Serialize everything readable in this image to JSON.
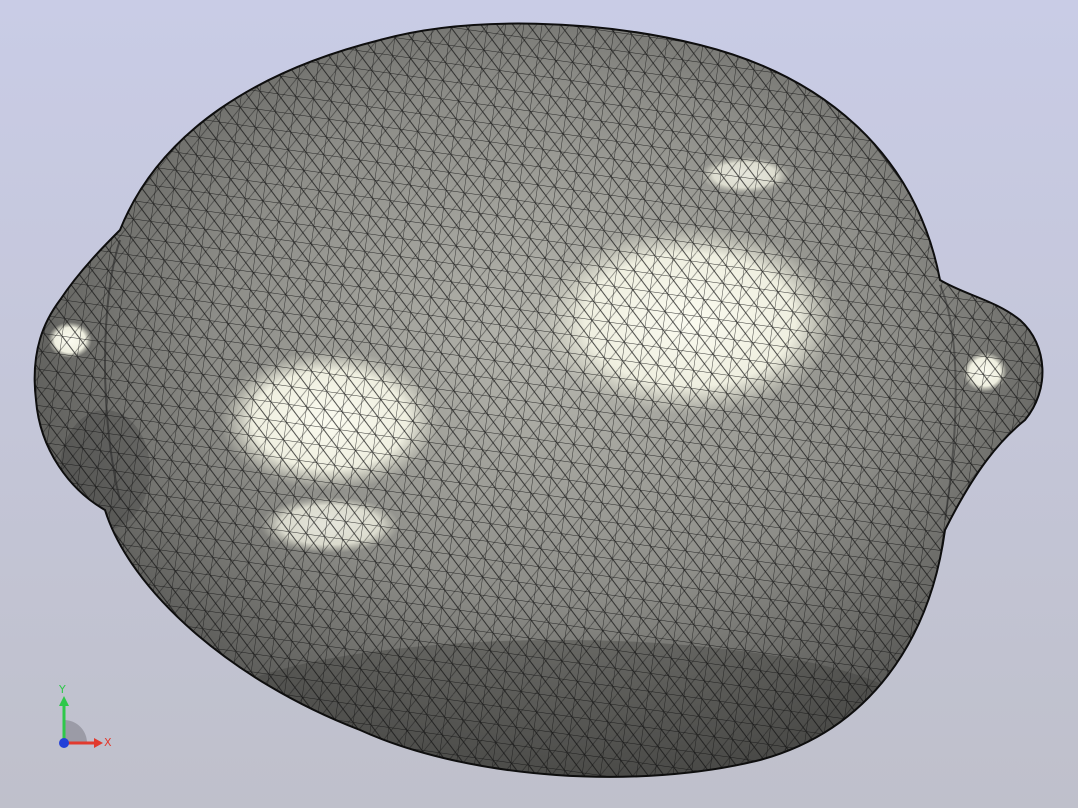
{
  "viewport": {
    "background_top": "#c9cce6",
    "background_bottom": "#bfc0cb"
  },
  "model": {
    "name": "lemon-mesh",
    "display_mode": "shaded-with-edges",
    "surface_color": "#8c8c88",
    "highlight_color": "#f6f6ea",
    "edge_color": "#141414"
  },
  "triad": {
    "x_label": "X",
    "y_label": "Y",
    "x_color": "#e23a2e",
    "y_color": "#2ec84a",
    "z_color": "#2340d8"
  }
}
